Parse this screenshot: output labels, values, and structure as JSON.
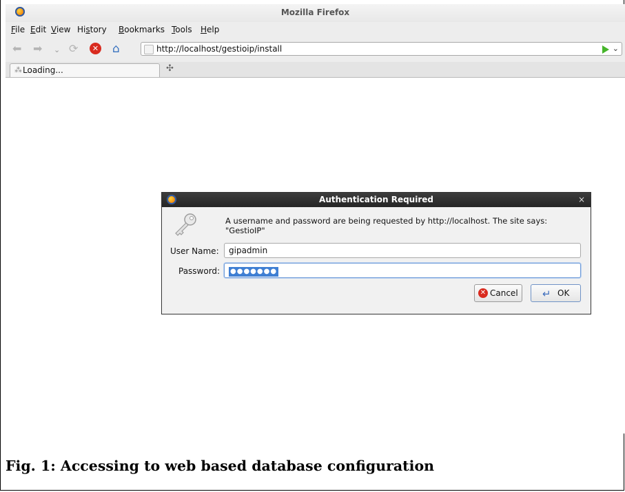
{
  "window": {
    "title": "Mozilla Firefox"
  },
  "menu": [
    {
      "pre": "",
      "u": "F",
      "post": "ile"
    },
    {
      "pre": "",
      "u": "E",
      "post": "dit"
    },
    {
      "pre": "",
      "u": "V",
      "post": "iew"
    },
    {
      "pre": "Hi",
      "u": "s",
      "post": "tory"
    },
    {
      "pre": "",
      "u": "B",
      "post": "ookmarks"
    },
    {
      "pre": "",
      "u": "T",
      "post": "ools"
    },
    {
      "pre": "",
      "u": "H",
      "post": "elp"
    }
  ],
  "nav": {
    "back_icon": "back-arrow-icon",
    "forward_icon": "forward-arrow-icon",
    "history_icon": "history-dropdown-icon",
    "reload_icon": "reload-icon",
    "stop_icon": "stop-icon",
    "home_icon": "home-icon",
    "url": "http://localhost/gestioip/install"
  },
  "tabs": [
    {
      "label": "Loading...",
      "active": true
    }
  ],
  "dialog": {
    "title": "Authentication Required",
    "message": "A username and password are being requested by http://localhost. The site says: \"GestioIP\"",
    "username_label": "User Name:",
    "username_value": "gipadmin",
    "password_label": "Password:",
    "password_mask": "●●●●●●●",
    "cancel_label": "Cancel",
    "ok_label": "OK"
  },
  "caption": "Fig. 1: Accessing to web based database configuration",
  "colors": {
    "stop": "#d92b1f",
    "go": "#46b52b",
    "dialog_title_bg": "#2d2d2d",
    "password_highlight": "#3f7fd3"
  }
}
